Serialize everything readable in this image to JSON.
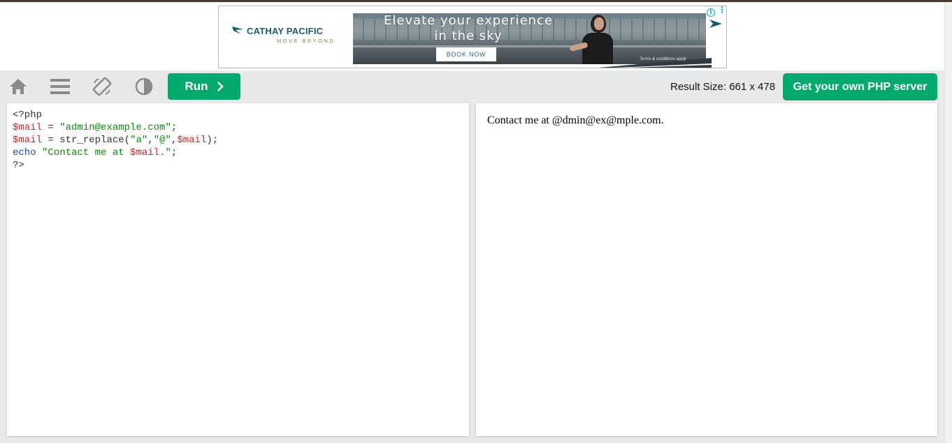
{
  "ad": {
    "brand": "CATHAY PACIFIC",
    "tagline": "MOVE BEYOND",
    "headline_line1": "Elevate your experience",
    "headline_line2": "in the sky",
    "cta": "BOOK NOW",
    "terms": "Terms & conditions apply",
    "info_label": "i",
    "brand_color": "#1d5c66"
  },
  "toolbar": {
    "icons": [
      "home-icon",
      "menu-icon",
      "rotate-icon",
      "contrast-icon"
    ],
    "run_label": "Run",
    "result_size_label": "Result Size: 661 x 478",
    "server_label": "Get your own PHP server",
    "accent_color": "#04aa6d"
  },
  "editor": {
    "lines": [
      [
        {
          "t": "<?php",
          "c": "tag"
        }
      ],
      [
        {
          "t": "$mail",
          "c": "var"
        },
        {
          "t": " = ",
          "c": "op"
        },
        {
          "t": "\"admin@example.com\"",
          "c": "str"
        },
        {
          "t": ";",
          "c": "op"
        }
      ],
      [
        {
          "t": "$mail",
          "c": "var"
        },
        {
          "t": " = ",
          "c": "op"
        },
        {
          "t": "str_replace(",
          "c": "fn"
        },
        {
          "t": "\"a\"",
          "c": "str"
        },
        {
          "t": ",",
          "c": "op"
        },
        {
          "t": "\"@\"",
          "c": "str"
        },
        {
          "t": ",",
          "c": "op"
        },
        {
          "t": "$mail",
          "c": "var"
        },
        {
          "t": ");",
          "c": "op"
        }
      ],
      [
        {
          "t": "echo",
          "c": "kw"
        },
        {
          "t": " ",
          "c": "op"
        },
        {
          "t": "\"Contact me at ",
          "c": "str"
        },
        {
          "t": "$mail",
          "c": "var"
        },
        {
          "t": ".\"",
          "c": "str"
        },
        {
          "t": ";",
          "c": "op"
        }
      ],
      [
        {
          "t": "?>",
          "c": "tag"
        }
      ]
    ]
  },
  "result": {
    "output": "Contact me at @dmin@ex@mple.com."
  }
}
